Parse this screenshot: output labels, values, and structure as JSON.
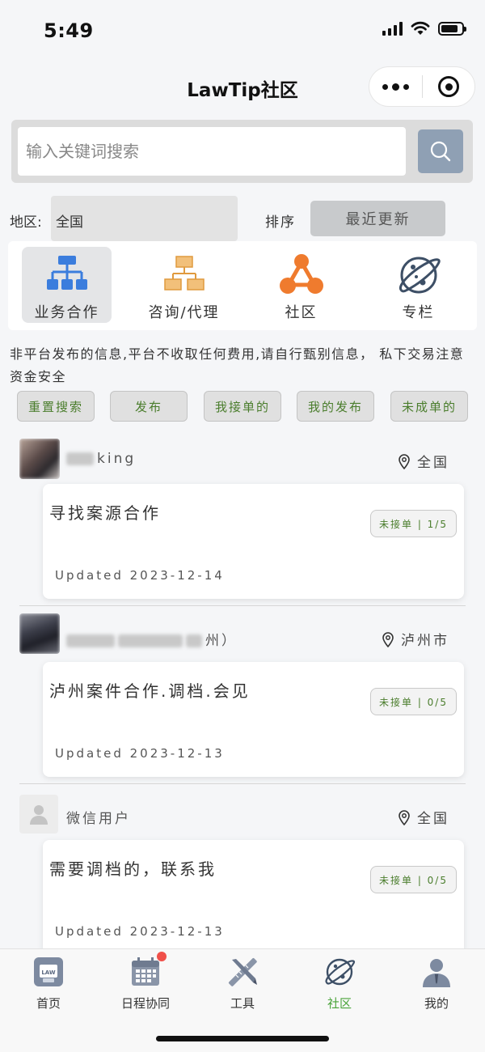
{
  "status_bar": {
    "time": "5:49"
  },
  "nav": {
    "title": "LawTip社区"
  },
  "search": {
    "placeholder": "输入关键词搜索"
  },
  "filter": {
    "region_label": "地区:",
    "region_value": "全国",
    "sort_label": "排序",
    "sort_value": "最近更新"
  },
  "categories": [
    {
      "label": "业务合作",
      "icon": "org-chart-blue-icon",
      "active": true
    },
    {
      "label": "咨询/代理",
      "icon": "org-chart-orange-icon",
      "active": false
    },
    {
      "label": "社区",
      "icon": "network-icon",
      "active": false
    },
    {
      "label": "专栏",
      "icon": "planet-icon",
      "active": false
    }
  ],
  "notice": "非平台发布的信息,平台不收取任何费用,请自行甄别信息， 私下交易注意资金安全",
  "actions": [
    "重置搜索",
    "发布",
    "我接单的",
    "我的发布",
    "未成单的"
  ],
  "posts": [
    {
      "user": "king",
      "location": "全国",
      "title": "寻找案源合作",
      "status": "未接单 | 1/5",
      "date": "Updated 2023-12-14"
    },
    {
      "user": "州）",
      "location": "泸州市",
      "title": "泸州案件合作.调档.会见",
      "status": "未接单 | 0/5",
      "date": "Updated 2023-12-13"
    },
    {
      "user": "微信用户",
      "location": "全国",
      "title": "需要调档的，联系我",
      "status": "未接单 | 0/5",
      "date": "Updated 2023-12-13"
    }
  ],
  "tabs": [
    {
      "label": "首页",
      "icon": "law-home-icon"
    },
    {
      "label": "日程协同",
      "icon": "calendar-icon"
    },
    {
      "label": "工具",
      "icon": "tools-icon"
    },
    {
      "label": "社区",
      "icon": "planet-icon",
      "active": true
    },
    {
      "label": "我的",
      "icon": "user-icon"
    }
  ],
  "colors": {
    "accent_green": "#4aa33a",
    "button_text_green": "#4a7d2c",
    "search_button": "#8fa0b4",
    "notification_red": "#f0504a"
  }
}
